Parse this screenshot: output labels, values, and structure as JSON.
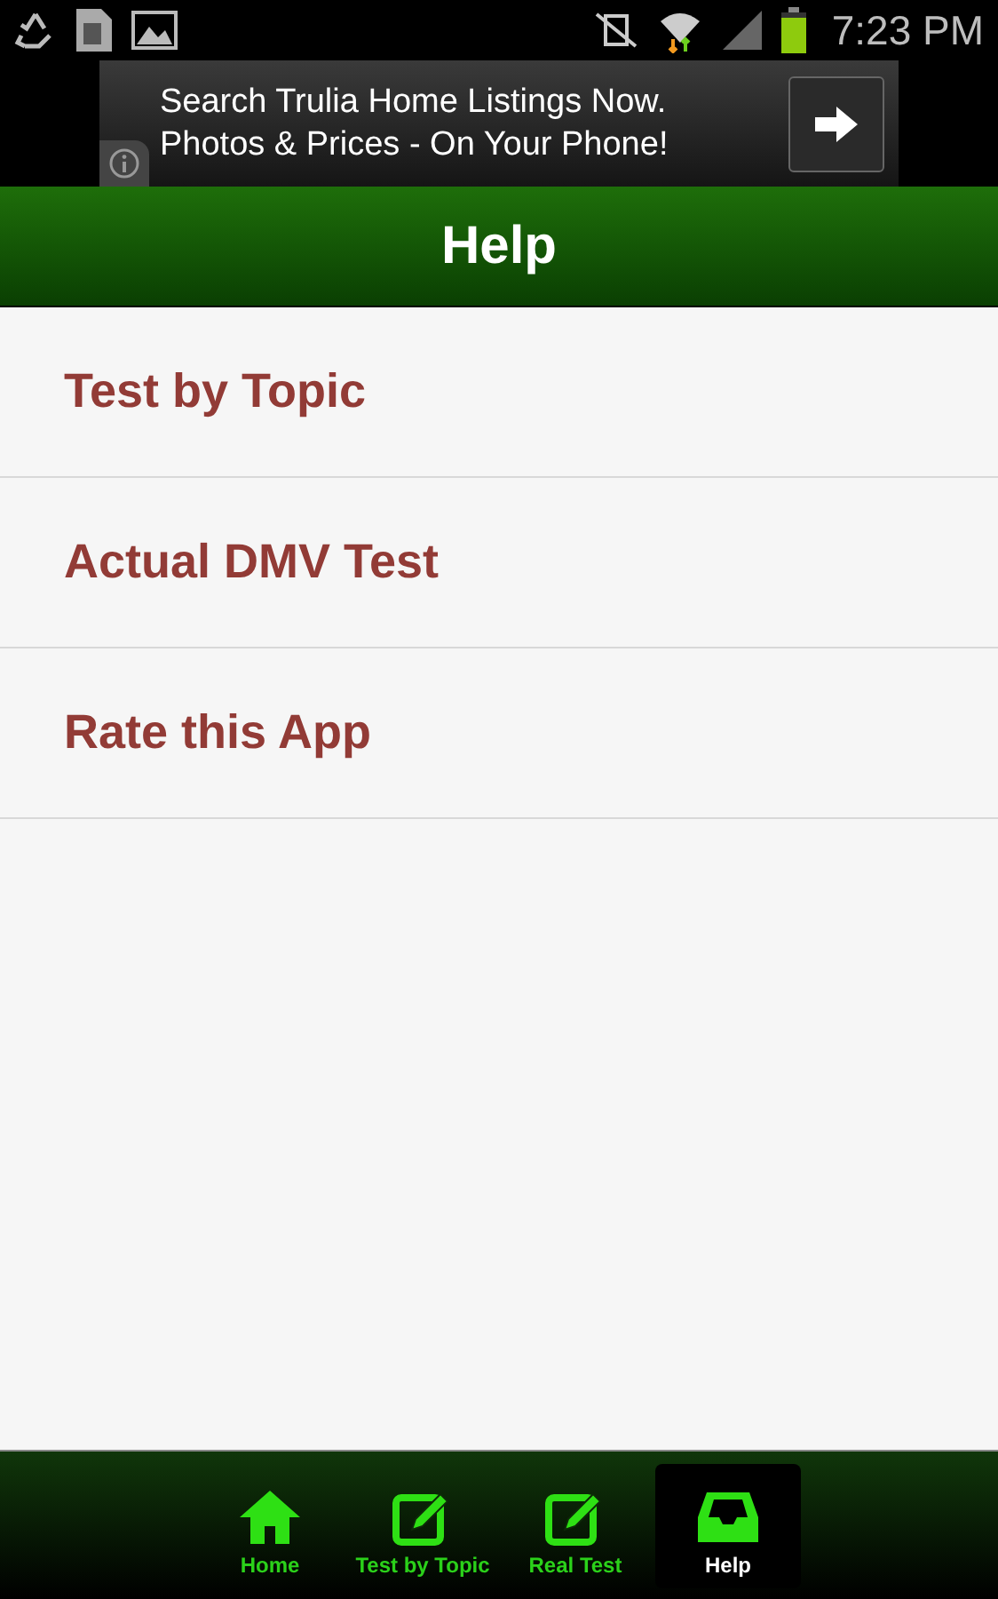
{
  "status_bar": {
    "time": "7:23 PM"
  },
  "ad": {
    "lines": [
      "Search Trulia Home Listings Now.",
      "Photos & Prices - On Your Phone!"
    ]
  },
  "header": {
    "title": "Help"
  },
  "menu": [
    {
      "label": "Test by Topic"
    },
    {
      "label": "Actual DMV Test"
    },
    {
      "label": "Rate this App"
    }
  ],
  "tabs": [
    {
      "label": "Home",
      "kind": "home",
      "selected": false
    },
    {
      "label": "Test by Topic",
      "kind": "edit",
      "selected": false
    },
    {
      "label": "Real Test",
      "kind": "edit",
      "selected": false
    },
    {
      "label": "Help",
      "kind": "inbox",
      "selected": true
    }
  ]
}
